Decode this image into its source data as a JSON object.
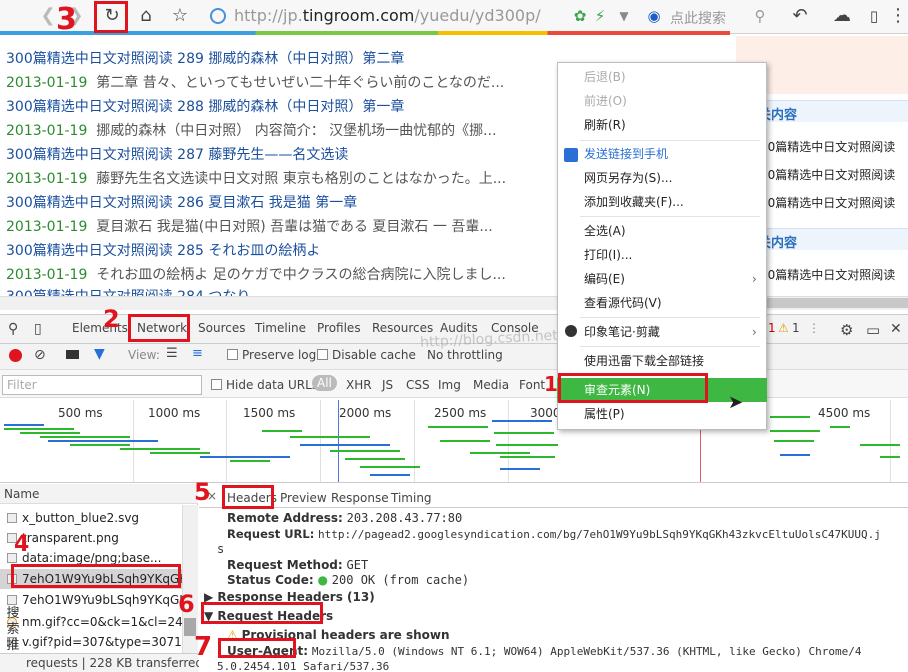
{
  "browser": {
    "url_prefix": "http://jp.",
    "url_domain": "tingroom.com",
    "url_path": "/yuedu/yd300p/",
    "search_placeholder": "点此搜索"
  },
  "page": {
    "rows": [
      {
        "title": "300篇精选中日文对照阅读 289 挪威的森林（中日对照）第二章",
        "date": "2013-01-19",
        "text": "第二章 昔々、といってもせいぜい二十年ぐらい前のことなのだ..."
      },
      {
        "title": "300篇精选中日文对照阅读 288 挪威的森林（中日对照）第一章",
        "date": "2013-01-19",
        "text": "挪威的森林（中日对照） 内容简介： 汉堡机场一曲忧郁的《挪..."
      },
      {
        "title": "300篇精选中日文对照阅读 287 藤野先生——名文选读",
        "date": "2013-01-19",
        "text": "藤野先生名文选读中日文对照 東京も格別のことはなかった。上..."
      },
      {
        "title": "300篇精选中日文对照阅读 286 夏目漱石 我是猫 第一章",
        "date": "2013-01-19",
        "text": "夏目漱石 我是猫(中日对照) 吾輩は猫である 夏目漱石 一 吾輩..."
      },
      {
        "title": "300篇精选中日文对照阅读 285 それお皿の絵柄よ",
        "date": "2013-01-19",
        "text": "それお皿の絵柄よ 足のケガで中クラスの総合病院に入院しまし..."
      }
    ],
    "partial_row": "300篇精选中日文对照阅读 284 つなり"
  },
  "sidebar": {
    "heading1": "关内容",
    "heading2": "关内容",
    "items": [
      "00篇精选中日文对照阅读",
      "00篇精选中日文对照阅读",
      "00篇精选中日文对照阅读",
      "00篇精选中日文对照阅读",
      "00篇精选中日文对照阅读"
    ]
  },
  "context_menu": {
    "items": [
      {
        "label": "后退(B)",
        "disabled": true
      },
      {
        "label": "前进(O)",
        "disabled": true
      },
      {
        "label": "刷新(R)",
        "disabled": false
      },
      {
        "label": "发送链接到手机",
        "disabled": false,
        "link": true
      },
      {
        "label": "网页另存为(S)...",
        "disabled": false
      },
      {
        "label": "添加到收藏夹(F)...",
        "disabled": false
      },
      {
        "label": "全选(A)",
        "disabled": false
      },
      {
        "label": "打印(I)...",
        "disabled": false
      },
      {
        "label": "编码(E)",
        "disabled": false
      },
      {
        "label": "查看源代码(V)",
        "disabled": false
      },
      {
        "label": "印象笔记·剪藏",
        "disabled": false
      },
      {
        "label": "使用迅雷下载全部链接",
        "disabled": false
      },
      {
        "label": "审查元素(N)",
        "disabled": false,
        "highlighted": true
      },
      {
        "label": "属性(P)",
        "disabled": false
      }
    ]
  },
  "devtools": {
    "tabs": [
      "Elements",
      "Network",
      "Sources",
      "Timeline",
      "Profiles",
      "Resources",
      "Audits",
      "Console"
    ],
    "errors": "1",
    "warnings": "1",
    "view_label": "View:",
    "preserve_log": "Preserve log",
    "disable_cache": "Disable cache",
    "throttling": "No throttling",
    "filter_placeholder": "Filter",
    "hide_data_urls": "Hide data URLs",
    "type_filters": [
      "All",
      "XHR",
      "JS",
      "CSS",
      "Img",
      "Media",
      "Font"
    ],
    "timeline_ticks": [
      "500 ms",
      "1000 ms",
      "1500 ms",
      "2000 ms",
      "2500 ms",
      "3000",
      "4500 ms"
    ],
    "name_header": "Name",
    "requests": [
      "x_button_blue2.svg",
      "transparent.png",
      "data:image/png;base...",
      "7ehO1W9Yu9bLSqh9YKqGK...",
      "7ehO1W9Yu9bLSqh9YKqGK...",
      "nm.gif?cc=0&ck=1&cl=24-...",
      "v.gif?pid=307&type=3071&..."
    ],
    "status_bar": "requests | 228 KB transferred",
    "detail_tabs": [
      "Headers",
      "Preview",
      "Response",
      "Timing"
    ],
    "remote_address_key": "Remote Address:",
    "remote_address": "203.208.43.77:80",
    "request_url_key": "Request URL:",
    "request_url": "http://pagead2.googlesyndication.com/bg/7ehO1W9Yu9bLSqh9YKqGKh43zkvcEltuUolsC47KUUQ.j",
    "request_url_wrap": "s",
    "request_method_key": "Request Method:",
    "request_method": "GET",
    "status_code_key": "Status Code:",
    "status_code": "200 OK (from cache)",
    "response_headers": "Response Headers (13)",
    "request_headers": "Request Headers",
    "provisional": "Provisional headers are shown",
    "user_agent_key": "User-Agent:",
    "user_agent": "Mozilla/5.0 (Windows NT 6.1; WOW64) AppleWebKit/537.36 (KHTML, like Gecko) Chrome/4",
    "user_agent_wrap": "5.0.2454.101 Safari/537.36"
  },
  "annotations": [
    "1",
    "2",
    "3",
    "4",
    "5",
    "6",
    "7"
  ],
  "side_label": "搜索推荐",
  "watermark": "http://blog.csdn.net/mnlmj",
  "colors": {
    "accent_green": "#3fb843",
    "annotation_red": "#e0141e",
    "link_blue": "#1a4f9e",
    "date_green": "#2e8b2e"
  }
}
